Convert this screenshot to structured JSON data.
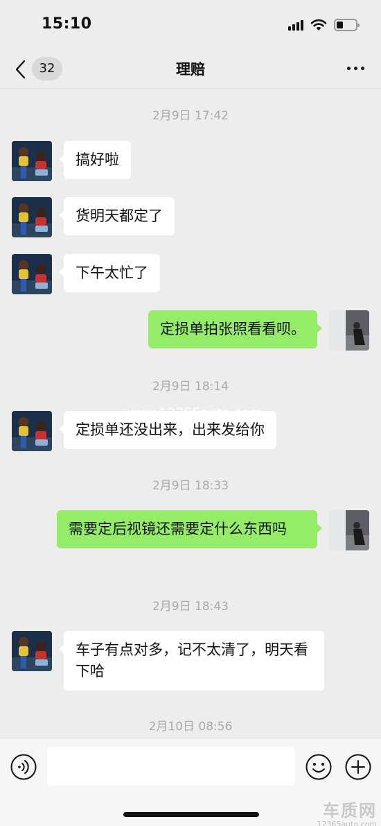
{
  "status_bar": {
    "time": "15:10"
  },
  "nav": {
    "unread_count": "32",
    "title": "理赔"
  },
  "timestamps": [
    "2月9日 17:42",
    "2月9日 18:14",
    "2月9日 18:33",
    "2月9日 18:43",
    "2月10日 08:56"
  ],
  "messages": [
    {
      "side": "in",
      "text": "搞好啦"
    },
    {
      "side": "in",
      "text": "货明天都定了"
    },
    {
      "side": "in",
      "text": "下午太忙了"
    },
    {
      "side": "out",
      "text": "定损单拍张照看看呗。"
    },
    {
      "side": "in",
      "text": "定损单还没出来，出来发给你"
    },
    {
      "side": "out",
      "text": "需要定后视镜还需要定什么东西吗"
    },
    {
      "side": "in",
      "text": "车子有点对多，记不太清了，明天看下哈"
    }
  ],
  "watermark": "www.12365auto.com",
  "corner_logo": {
    "name": "车质网",
    "url": "12365auto.com"
  },
  "colors": {
    "background": "#ededed",
    "outgoing_bubble": "#95ec69",
    "incoming_bubble": "#ffffff",
    "timestamp": "#aaaaaa"
  },
  "icons": [
    "signal-icon",
    "wifi-icon",
    "battery-icon",
    "back-chevron-icon",
    "more-icon",
    "voice-icon",
    "emoji-icon",
    "plus-icon"
  ]
}
